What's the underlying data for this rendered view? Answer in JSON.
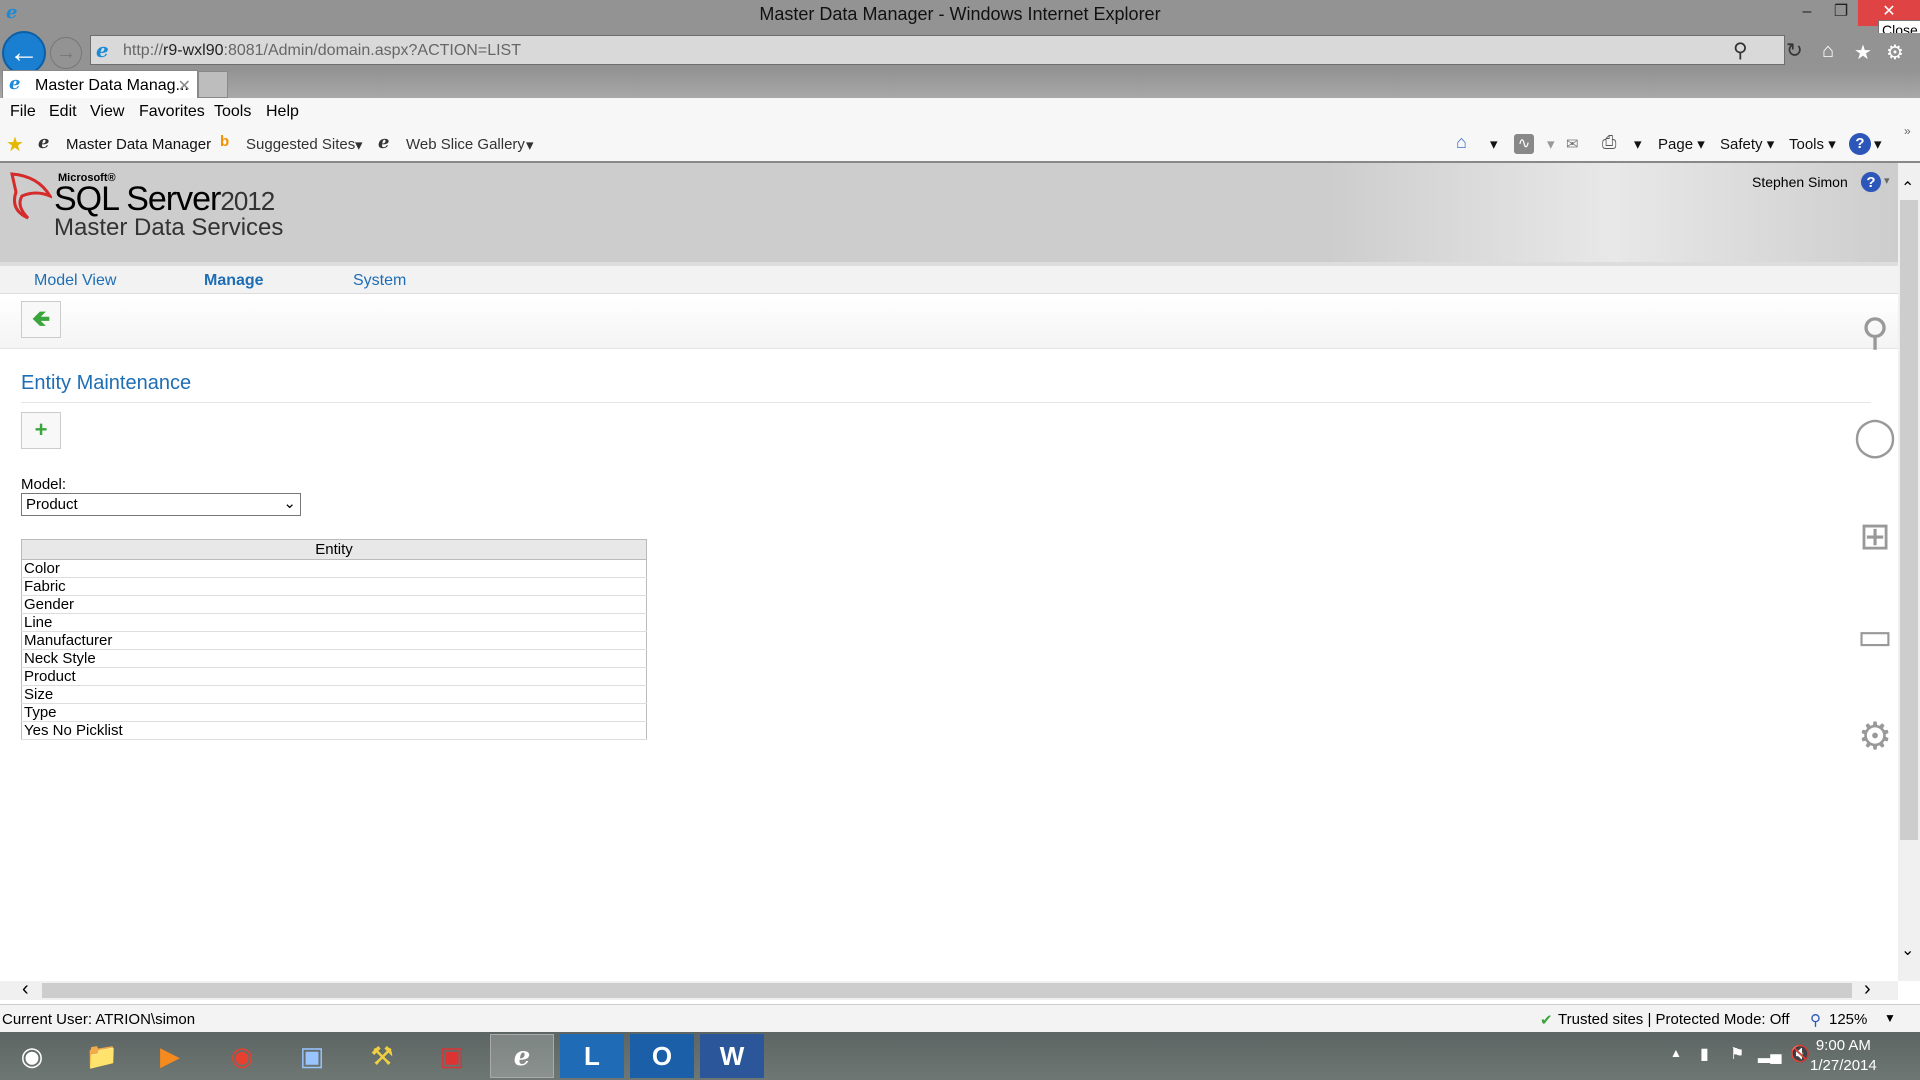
{
  "window": {
    "title": "Master Data Manager - Windows Internet Explorer",
    "close_tooltip": "Close"
  },
  "browser": {
    "url_prefix": "http://",
    "url_host": "r9-wxl90",
    "url_rest": ":8081/Admin/domain.aspx?ACTION=LIST",
    "tab_label": "Master Data Manag...",
    "menu": [
      "File",
      "Edit",
      "View",
      "Favorites",
      "Tools",
      "Help"
    ],
    "favorites": [
      "Master Data Manager",
      "Suggested Sites",
      "Web Slice Gallery"
    ],
    "commands": [
      "Page",
      "Safety",
      "Tools"
    ]
  },
  "app": {
    "logo_microsoft": "Microsoft®",
    "logo_product": "SQL Server",
    "logo_year": "2012",
    "logo_sub": "Master Data Services",
    "user": "Stephen Simon",
    "nav": [
      "Model View",
      "Manage",
      "System"
    ],
    "page_title": "Entity Maintenance",
    "model_label": "Model:",
    "model_value": "Product",
    "table": {
      "header": "Entity",
      "rows": [
        "Color",
        "Fabric",
        "Gender",
        "Line",
        "Manufacturer",
        "Neck Style",
        "Product",
        "Size",
        "Type",
        "Yes No Picklist"
      ]
    },
    "side_icons": [
      "search-icon",
      "globe-icon",
      "windows-icon",
      "devices-icon",
      "gear-icon"
    ]
  },
  "status": {
    "user": "Current User: ATRION\\simon",
    "zone": "Trusted sites | Protected Mode: Off",
    "zoom": "125%"
  },
  "clock": {
    "time": "9:00 AM",
    "date": "1/27/2014"
  },
  "colors": {
    "accent": "#1e6eb5",
    "close": "#e04343"
  }
}
